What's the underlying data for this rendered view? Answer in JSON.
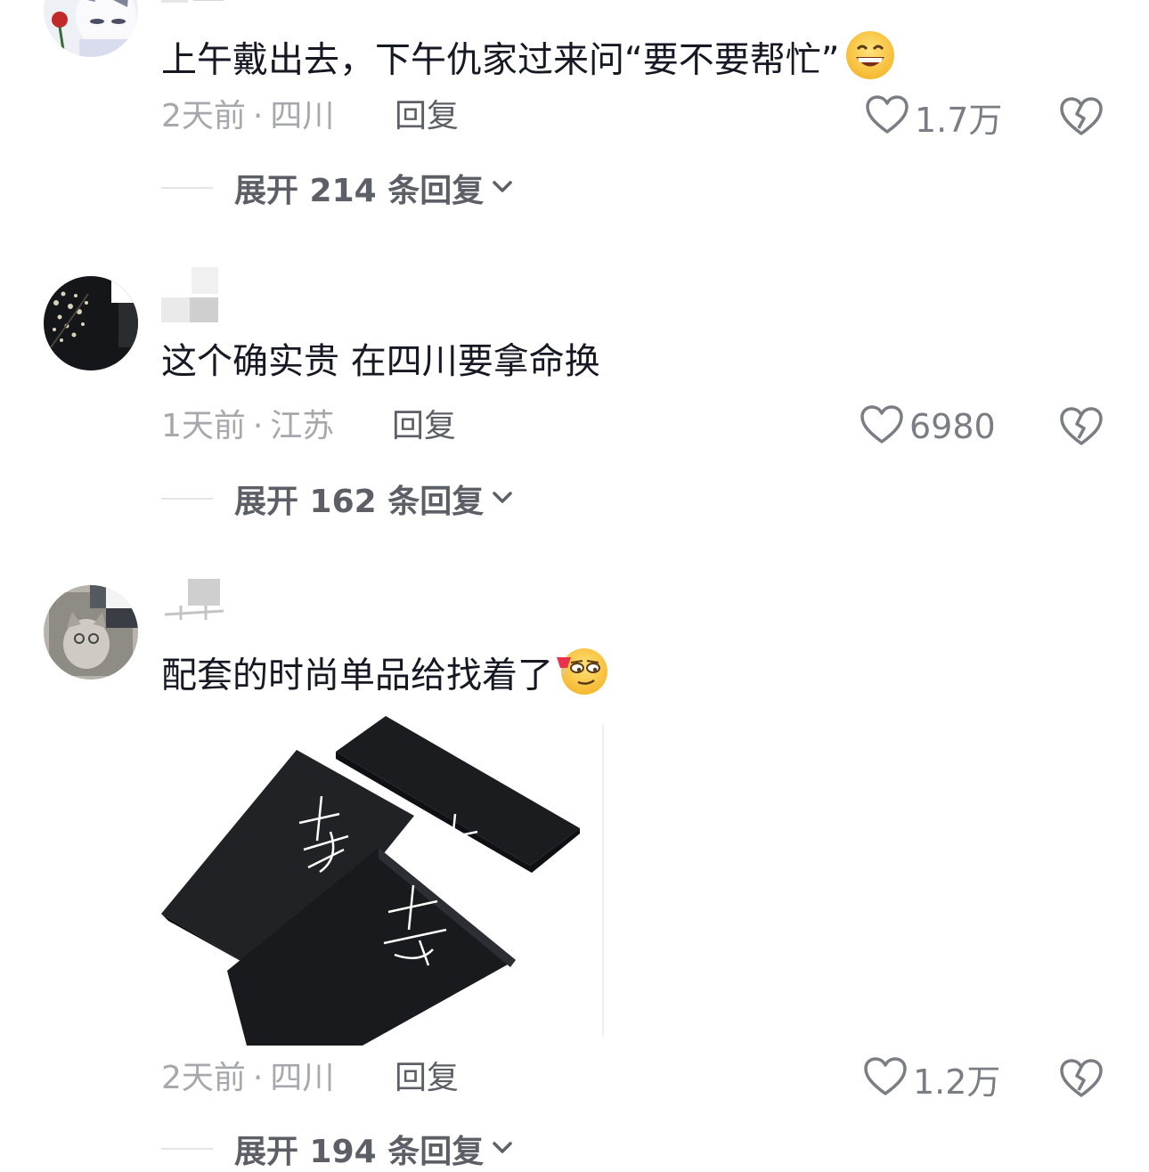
{
  "comments": [
    {
      "text": "上午戴出去，下午仇家过来问“要不要帮忙”",
      "emoji": "grinning-face-emoji",
      "time": "2天前",
      "separator": "·",
      "location": "四川",
      "reply_label": "回复",
      "likes": "1.7万",
      "expand_label": "展开 214 条回复"
    },
    {
      "text": "这个确实贵 在四川要拿命换",
      "time": "1天前",
      "separator": "·",
      "location": "江苏",
      "reply_label": "回复",
      "likes": "6980",
      "expand_label": "展开 162 条回复"
    },
    {
      "text": "配套的时尚单品给找着了",
      "emoji": "smirking-wine-face-emoji",
      "time": "2天前",
      "separator": "·",
      "location": "四川",
      "reply_label": "回复",
      "likes": "1.2万",
      "expand_label": "展开 194 条回复",
      "image": {
        "description_icon": "black-mourning-armbands",
        "armband_chars": [
          "孝",
          "孝",
          "孝"
        ]
      }
    }
  ],
  "icons": {
    "like": "heart-outline-icon",
    "dislike": "broken-heart-icon",
    "expand": "chevron-down-icon"
  },
  "colors": {
    "text_primary": "#161823",
    "text_meta": "#a7a8ad",
    "text_secondary": "#5d5f67",
    "divider": "#e4e5e8"
  }
}
